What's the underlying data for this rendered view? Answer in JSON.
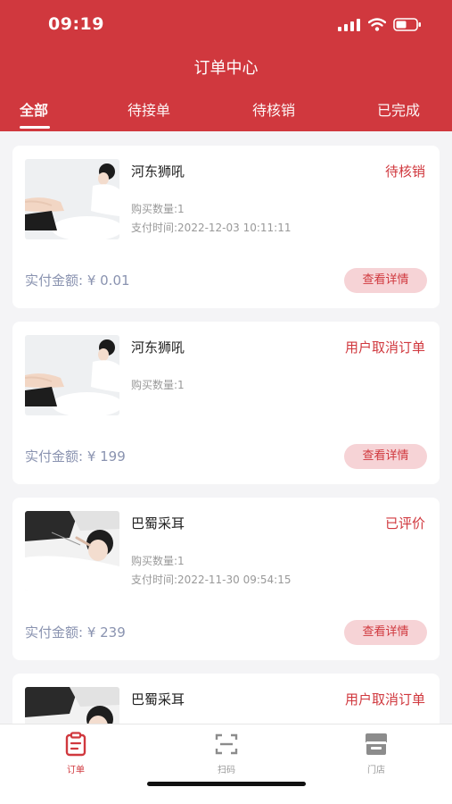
{
  "status_bar": {
    "time": "09:19"
  },
  "header": {
    "title": "订单中心"
  },
  "tabs": [
    {
      "label": "全部"
    },
    {
      "label": "待接单"
    },
    {
      "label": "待核销"
    },
    {
      "label": "已完成"
    }
  ],
  "orders": [
    {
      "name": "河东狮吼",
      "status": "待核销",
      "quantity": "购买数量:1",
      "paytime": "支付时间:2022-12-03 10:11:11",
      "amount": "实付金额: ¥ 0.01",
      "button": "查看详情"
    },
    {
      "name": "河东狮吼",
      "status": "用户取消订单",
      "quantity": "购买数量:1",
      "amount": "实付金额: ¥ 199",
      "button": "查看详情"
    },
    {
      "name": "巴蜀采耳",
      "status": "已评价",
      "quantity": "购买数量:1",
      "paytime": "支付时间:2022-11-30 09:54:15",
      "amount": "实付金额: ¥ 239",
      "button": "查看详情"
    },
    {
      "name": "巴蜀采耳",
      "status": "用户取消订单"
    }
  ],
  "bottom_nav": [
    {
      "label": "订单",
      "icon": "clipboard-icon"
    },
    {
      "label": "扫码",
      "icon": "scan-icon"
    },
    {
      "label": "门店",
      "icon": "store-icon"
    }
  ],
  "colors": {
    "brand": "#d0383e",
    "amount": "#8a93b0",
    "button_bg": "#f6d3d6"
  }
}
